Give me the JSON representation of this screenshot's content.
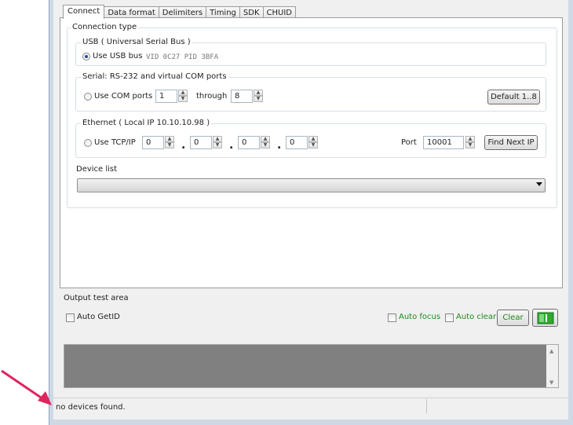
{
  "tabs": [
    "Connect",
    "Data format",
    "Delimiters",
    "Timing",
    "SDK",
    "CHUID"
  ],
  "connection_type": {
    "title": "Connection type",
    "usb": {
      "group_label": "USB ( Universal Serial Bus )",
      "option_label": "Use USB bus",
      "info": "VID 0C27  PID 3BFA",
      "selected": true
    },
    "serial": {
      "group_label": "Serial: RS-232 and virtual COM ports",
      "option_label": "Use COM ports",
      "from": "1",
      "through_label": "through",
      "to": "8",
      "default_button": "Default 1..8"
    },
    "ethernet": {
      "group_label": "Ethernet ( Local IP 10.10.10.98 )",
      "option_label": "Use TCP/IP",
      "ip": [
        "0",
        "0",
        "0",
        "0"
      ],
      "port_label": "Port",
      "port": "10001",
      "find_button": "Find Next IP"
    },
    "device_list": {
      "label": "Device list",
      "value": ""
    }
  },
  "output": {
    "title": "Output test area",
    "auto_getid": "Auto GetID",
    "auto_focus": "Auto focus",
    "auto_clear": "Auto clear",
    "clear_button": "Clear",
    "accent_green": "#1e8a1e"
  },
  "status": {
    "text": "no devices found."
  },
  "annotation_arrow_color": "#e0245e"
}
